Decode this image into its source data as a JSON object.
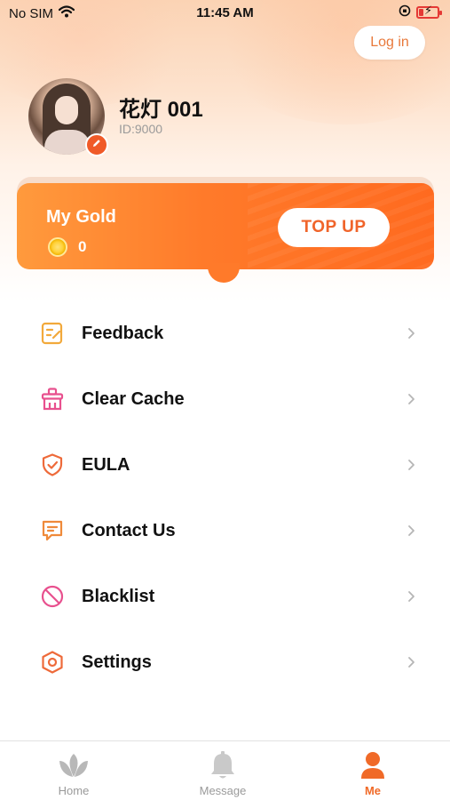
{
  "status_bar": {
    "carrier": "No SIM",
    "time": "11:45 AM"
  },
  "header": {
    "login_label": "Log in"
  },
  "profile": {
    "username": "花灯 001",
    "user_id": "ID:9000"
  },
  "gold": {
    "title": "My Gold",
    "amount": "0",
    "topup_label": "TOP UP"
  },
  "menu": {
    "items": [
      {
        "label": "Feedback",
        "icon": "feedback-icon"
      },
      {
        "label": "Clear Cache",
        "icon": "clear-cache-icon"
      },
      {
        "label": "EULA",
        "icon": "shield-check-icon"
      },
      {
        "label": "Contact Us",
        "icon": "chat-icon"
      },
      {
        "label": "Blacklist",
        "icon": "block-icon"
      },
      {
        "label": "Settings",
        "icon": "settings-icon"
      }
    ]
  },
  "tabbar": {
    "tabs": [
      {
        "label": "Home",
        "icon": "home-lotus-icon",
        "active": false
      },
      {
        "label": "Message",
        "icon": "bell-icon",
        "active": false
      },
      {
        "label": "Me",
        "icon": "person-icon",
        "active": true
      }
    ]
  },
  "colors": {
    "accent": "#f06a28",
    "gold_card_start": "#ff9a3d",
    "gold_card_end": "#ff6a1f",
    "inactive_tab": "#9a9a9a"
  }
}
